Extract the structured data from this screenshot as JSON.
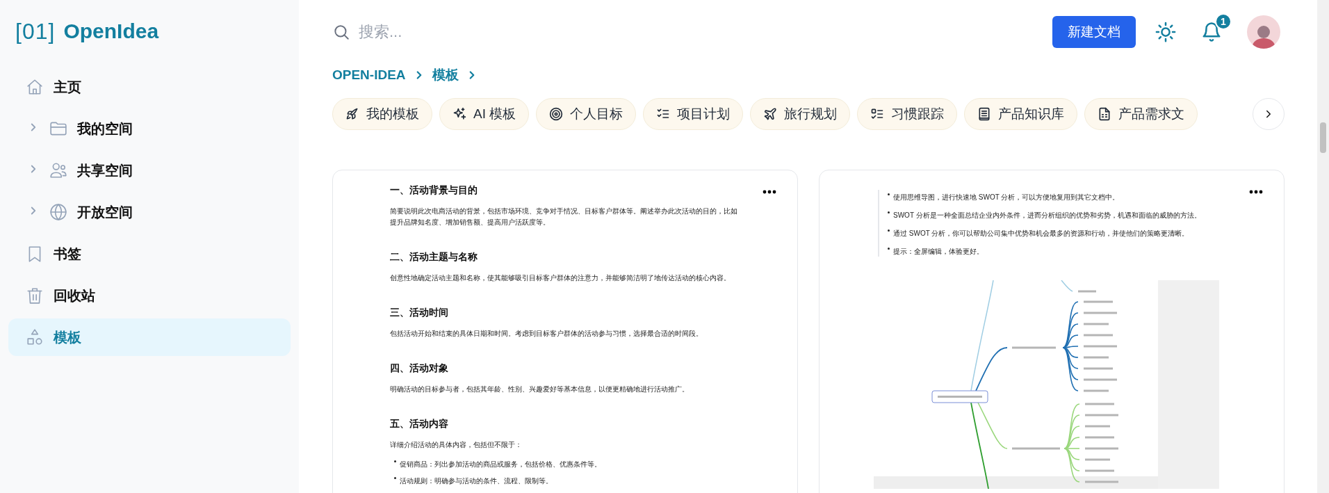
{
  "logo": {
    "mark": "[01]",
    "name": "OpenIdea"
  },
  "sidebar": {
    "items": [
      {
        "kind": "home",
        "label": "主页",
        "expandable": false,
        "selected": false
      },
      {
        "kind": "folder",
        "label": "我的空间",
        "expandable": true,
        "selected": false
      },
      {
        "kind": "users",
        "label": "共享空间",
        "expandable": true,
        "selected": false
      },
      {
        "kind": "globe",
        "label": "开放空间",
        "expandable": true,
        "selected": false
      },
      {
        "kind": "bookmark",
        "label": "书签",
        "expandable": false,
        "selected": false
      },
      {
        "kind": "trash",
        "label": "回收站",
        "expandable": false,
        "selected": false
      },
      {
        "kind": "shapes",
        "label": "模板",
        "expandable": false,
        "selected": true
      }
    ]
  },
  "search": {
    "placeholder": "搜索..."
  },
  "new_doc_button": "新建文档",
  "notifications": {
    "badge": "1"
  },
  "breadcrumb": [
    "OPEN-IDEA",
    "模板"
  ],
  "categories": [
    {
      "kind": "rocket",
      "label": "我的模板"
    },
    {
      "kind": "sparkles",
      "label": "AI 模板"
    },
    {
      "kind": "target",
      "label": "个人目标"
    },
    {
      "kind": "checklist",
      "label": "项目计划"
    },
    {
      "kind": "plane",
      "label": "旅行规划"
    },
    {
      "kind": "todo",
      "label": "习惯跟踪"
    },
    {
      "kind": "book",
      "label": "产品知识库"
    },
    {
      "kind": "file",
      "label": "产品需求文"
    }
  ],
  "cards": [
    {
      "blocks": [
        {
          "kind": "heading",
          "text": "一、活动背景与目的"
        },
        {
          "kind": "paragraph",
          "text": "简要说明此次电商活动的背景，包括市场环境、竞争对手情况、目标客户群体等。阐述举办此次活动的目的，比如提升品牌知名度、增加销售额、提高用户活跃度等。"
        },
        {
          "kind": "heading",
          "text": "二、活动主题与名称"
        },
        {
          "kind": "paragraph",
          "text": "创意性地确定活动主题和名称，使其能够吸引目标客户群体的注意力，并能够简洁明了地传达活动的核心内容。"
        },
        {
          "kind": "heading",
          "text": "三、活动时间"
        },
        {
          "kind": "paragraph",
          "text": "包括活动开始和结束的具体日期和时间。考虑到目标客户群体的活动参与习惯，选择最合适的时间段。"
        },
        {
          "kind": "heading",
          "text": "四、活动对象"
        },
        {
          "kind": "paragraph",
          "text": "明确活动的目标参与者，包括其年龄、性别、兴趣爱好等基本信息，以便更精确地进行活动推广。"
        },
        {
          "kind": "heading",
          "text": "五、活动内容"
        },
        {
          "kind": "paragraph",
          "text": "详细介绍活动的具体内容，包括但不限于："
        },
        {
          "kind": "bullet",
          "text": "促销商品：列出参加活动的商品或服务，包括价格、优惠条件等。"
        },
        {
          "kind": "bullet",
          "text": "活动规则：明确参与活动的条件、流程、限制等。"
        }
      ]
    },
    {
      "blocks": [
        {
          "kind": "quote_bullets",
          "items": [
            "使用思维导图，进行快速地 SWOT 分析，可以方便地复用到其它文档中。",
            "SWOT 分析是一种全面总结企业内外条件，进而分析组织的优势和劣势，机遇和面临的威胁的方法。",
            "通过 SWOT 分析，你可以帮助公司集中优势和机会最多的资源和行动，并使他们的策略更清晰。",
            "提示：全屏编辑，体验更好。"
          ]
        },
        {
          "kind": "mindmap"
        }
      ]
    }
  ]
}
